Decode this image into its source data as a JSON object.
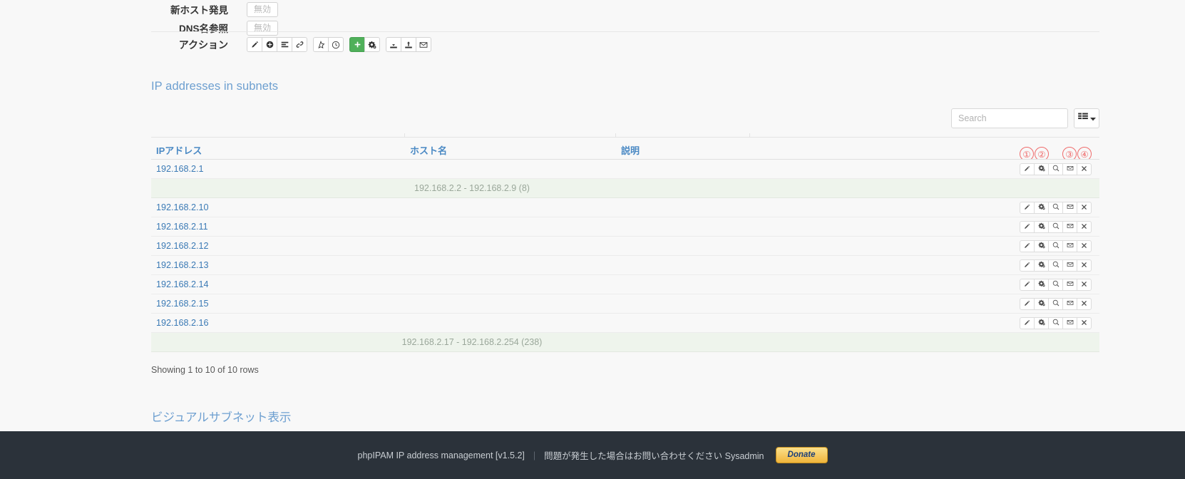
{
  "settings": {
    "rows": [
      {
        "label": "新ホスト発見",
        "value": "無効"
      },
      {
        "label": "DNS名参照",
        "value": "無効"
      }
    ],
    "actions_label": "アクション",
    "action_buttons": [
      {
        "name": "edit-subnet-button",
        "icon": "pencil-icon",
        "group": 1,
        "style": "default"
      },
      {
        "name": "add-ip-button",
        "icon": "plus-circle-icon",
        "group": 1,
        "style": "default"
      },
      {
        "name": "scan-subnet-button",
        "icon": "list-icon",
        "group": 1,
        "style": "default"
      },
      {
        "name": "link-subnet-button",
        "icon": "link-icon",
        "group": 1,
        "style": "default"
      },
      {
        "name": "favourite-button",
        "icon": "star-icon",
        "group": 2,
        "style": "default"
      },
      {
        "name": "history-button",
        "icon": "clock-icon",
        "group": 2,
        "style": "default"
      },
      {
        "name": "create-ip-button",
        "icon": "plus-icon",
        "group": 3,
        "style": "green"
      },
      {
        "name": "subnet-settings-button",
        "icon": "gears-icon",
        "group": 3,
        "style": "default"
      },
      {
        "name": "import-button",
        "icon": "download-icon",
        "group": 4,
        "style": "default"
      },
      {
        "name": "export-button",
        "icon": "upload-icon",
        "group": 4,
        "style": "default"
      },
      {
        "name": "email-button",
        "icon": "envelope-icon",
        "group": 4,
        "style": "default"
      }
    ]
  },
  "section": {
    "title": "IP addresses in subnets"
  },
  "search": {
    "placeholder": "Search",
    "value": "",
    "columns_button_icon": "table-columns-icon"
  },
  "table": {
    "columns": [
      {
        "key": "ip",
        "label": "IPアドレス"
      },
      {
        "key": "host",
        "label": "ホスト名"
      },
      {
        "key": "desc",
        "label": "説明"
      },
      {
        "key": "act",
        "label": ""
      }
    ],
    "row_actions": [
      {
        "name": "row-edit-button",
        "icon": "pencil-icon"
      },
      {
        "name": "row-tools-button",
        "icon": "gears-icon"
      },
      {
        "name": "row-search-button",
        "icon": "magnifier-icon"
      },
      {
        "name": "row-mail-button",
        "icon": "envelope-icon"
      },
      {
        "name": "row-delete-button",
        "icon": "close-x-icon"
      }
    ],
    "rows": [
      {
        "type": "ip",
        "ip": "192.168.2.1",
        "host": "",
        "desc": ""
      },
      {
        "type": "free",
        "text": "192.168.2.2 - 192.168.2.9 (8)"
      },
      {
        "type": "ip",
        "ip": "192.168.2.10",
        "host": "",
        "desc": ""
      },
      {
        "type": "ip",
        "ip": "192.168.2.11",
        "host": "",
        "desc": ""
      },
      {
        "type": "ip",
        "ip": "192.168.2.12",
        "host": "",
        "desc": ""
      },
      {
        "type": "ip",
        "ip": "192.168.2.13",
        "host": "",
        "desc": ""
      },
      {
        "type": "ip",
        "ip": "192.168.2.14",
        "host": "",
        "desc": ""
      },
      {
        "type": "ip",
        "ip": "192.168.2.15",
        "host": "",
        "desc": ""
      },
      {
        "type": "ip",
        "ip": "192.168.2.16",
        "host": "",
        "desc": ""
      },
      {
        "type": "free",
        "text": "192.168.2.17 - 192.168.2.254 (238)"
      }
    ],
    "showing": "Showing 1 to 10 of 10 rows"
  },
  "annotations": {
    "markers": [
      "①",
      "②",
      "③",
      "④"
    ],
    "color": "#ef6b6b"
  },
  "visual": {
    "title": "ビジュアルサブネット表示"
  },
  "footer": {
    "app": "phpIPAM IP address management [v1.5.2]",
    "separator": "|",
    "support": "問題が発生した場合はお問い合わせください Sysadmin",
    "donate_label": "Donate"
  },
  "colors": {
    "link": "#3b7ab5",
    "heading": "#6d9fd0",
    "green": "#4fb05a",
    "free_row_bg": "#eef4ec",
    "footer_bg": "#2b323a"
  }
}
